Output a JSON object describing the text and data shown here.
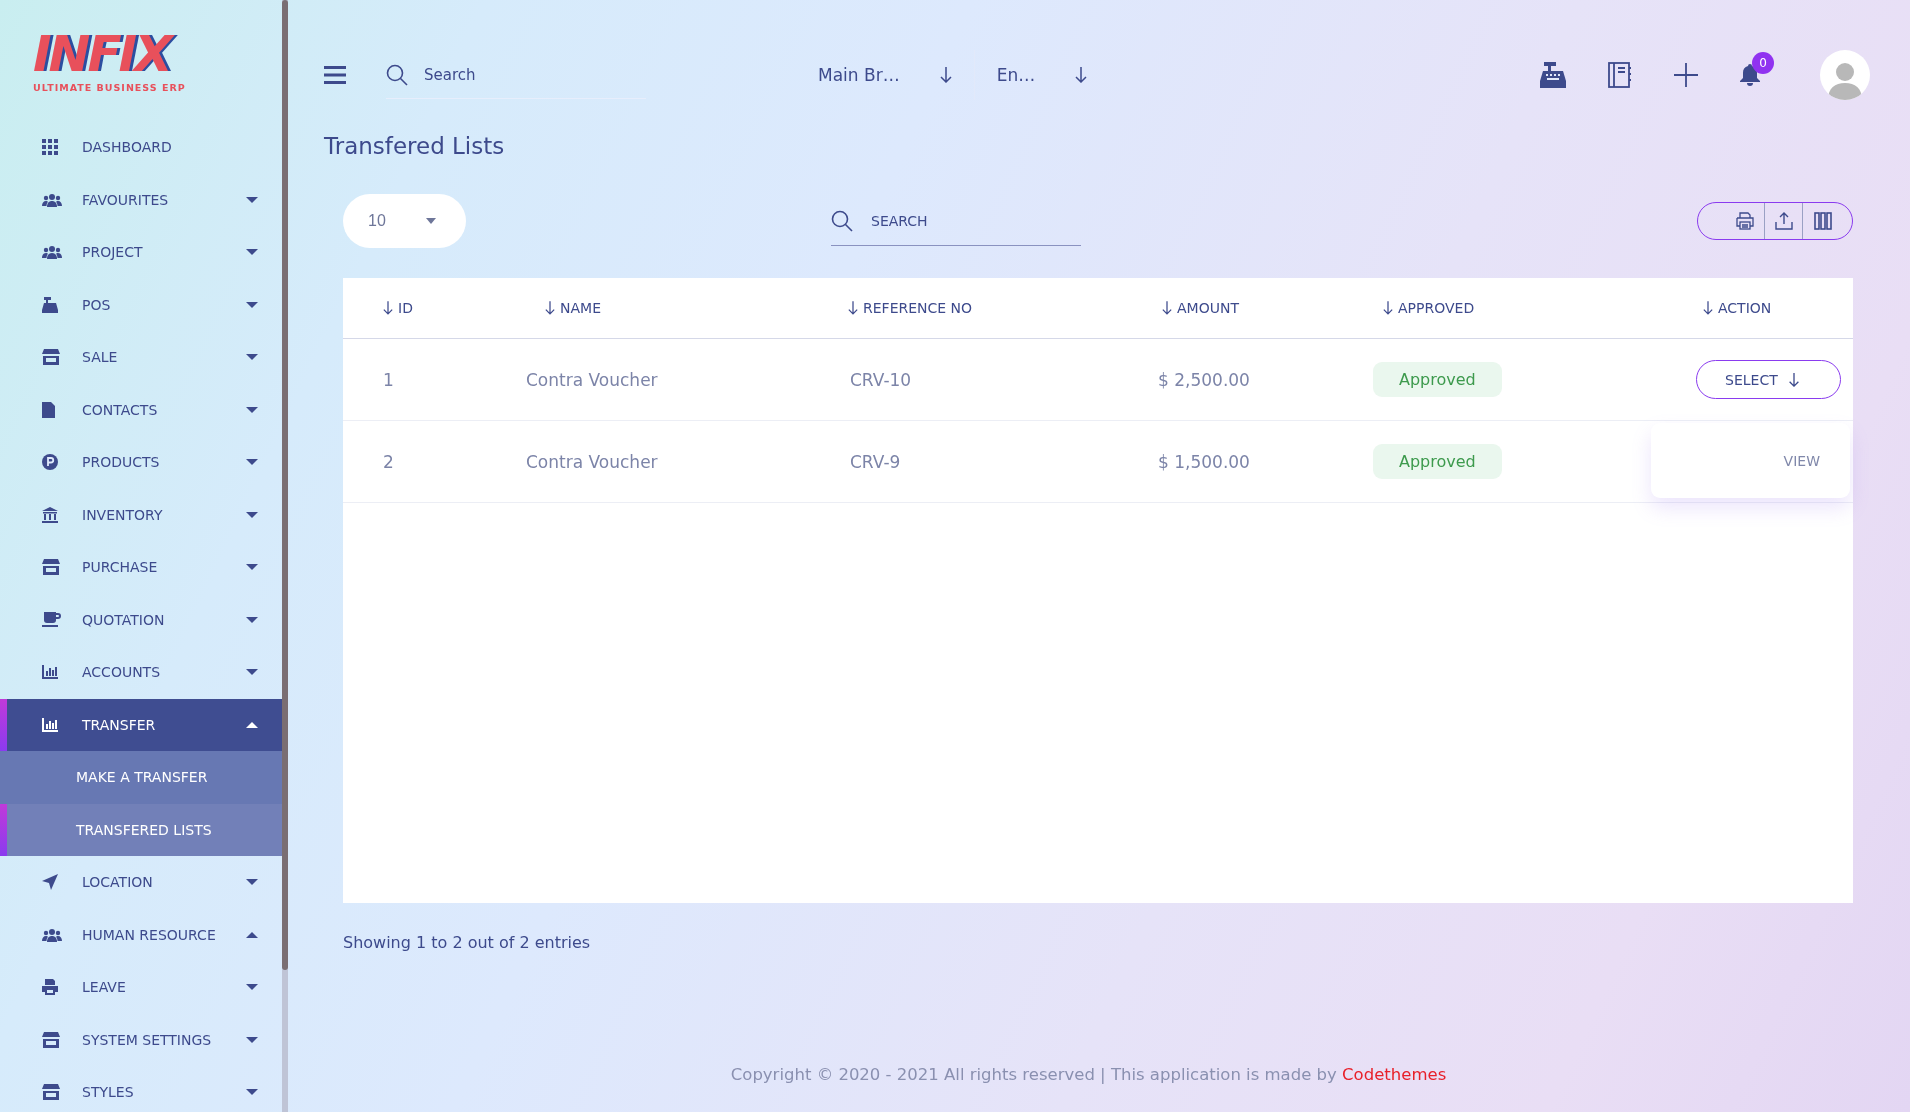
{
  "logo": {
    "name": "INFIX",
    "tagline": "ULTIMATE BUSINESS ERP"
  },
  "sidebar": {
    "items": [
      {
        "label": "DASHBOARD",
        "has_submenu": false,
        "selected": false
      },
      {
        "label": "FAVOURITES",
        "has_submenu": true,
        "expanded": false,
        "selected": false
      },
      {
        "label": "PROJECT",
        "has_submenu": true,
        "expanded": false,
        "selected": false
      },
      {
        "label": "POS",
        "has_submenu": true,
        "expanded": false,
        "selected": false
      },
      {
        "label": "SALE",
        "has_submenu": true,
        "expanded": false,
        "selected": false
      },
      {
        "label": "CONTACTS",
        "has_submenu": true,
        "expanded": false,
        "selected": false
      },
      {
        "label": "PRODUCTS",
        "has_submenu": true,
        "expanded": false,
        "selected": false
      },
      {
        "label": "INVENTORY",
        "has_submenu": true,
        "expanded": false,
        "selected": false
      },
      {
        "label": "PURCHASE",
        "has_submenu": true,
        "expanded": false,
        "selected": false
      },
      {
        "label": "QUOTATION",
        "has_submenu": true,
        "expanded": false,
        "selected": false
      },
      {
        "label": "ACCOUNTS",
        "has_submenu": true,
        "expanded": false,
        "selected": false
      },
      {
        "label": "TRANSFER",
        "has_submenu": true,
        "expanded": true,
        "selected": true,
        "children": [
          {
            "label": "MAKE A TRANSFER",
            "selected": false
          },
          {
            "label": "TRANSFERED LISTS",
            "selected": true
          }
        ]
      },
      {
        "label": "LOCATION",
        "has_submenu": true,
        "expanded": false,
        "selected": false
      },
      {
        "label": "HUMAN RESOURCE",
        "has_submenu": true,
        "expanded": true,
        "selected": false
      },
      {
        "label": "LEAVE",
        "has_submenu": true,
        "expanded": false,
        "selected": false
      },
      {
        "label": "SYSTEM SETTINGS",
        "has_submenu": true,
        "expanded": false,
        "selected": false
      },
      {
        "label": "STYLES",
        "has_submenu": true,
        "expanded": false,
        "selected": false
      }
    ]
  },
  "header": {
    "search": {
      "placeholder": "Search"
    },
    "branch": "Main Br…",
    "language": "En…",
    "notifications": "0"
  },
  "page_title": "Transfered Lists",
  "page_size": "10",
  "table_search": {
    "placeholder": "SEARCH"
  },
  "table": {
    "columns": [
      "ID",
      "NAME",
      "REFERENCE NO",
      "AMOUNT",
      "APPROVED",
      "ACTION"
    ],
    "rows": [
      {
        "id": "1",
        "name": "Contra Voucher",
        "reference": "CRV-10",
        "amount": "$ 2,500.00",
        "approved": "Approved",
        "action": "SELECT"
      },
      {
        "id": "2",
        "name": "Contra Voucher",
        "reference": "CRV-9",
        "amount": "$ 1,500.00",
        "approved": "Approved"
      }
    ]
  },
  "action_menu": {
    "open": true,
    "items": [
      "VIEW"
    ]
  },
  "entries_info": "Showing 1 to 2 out of 2 entries",
  "footer": {
    "text": "Copyright © 2020 - 2021 All rights reserved | This application is made by ",
    "link": "Codethemes"
  }
}
